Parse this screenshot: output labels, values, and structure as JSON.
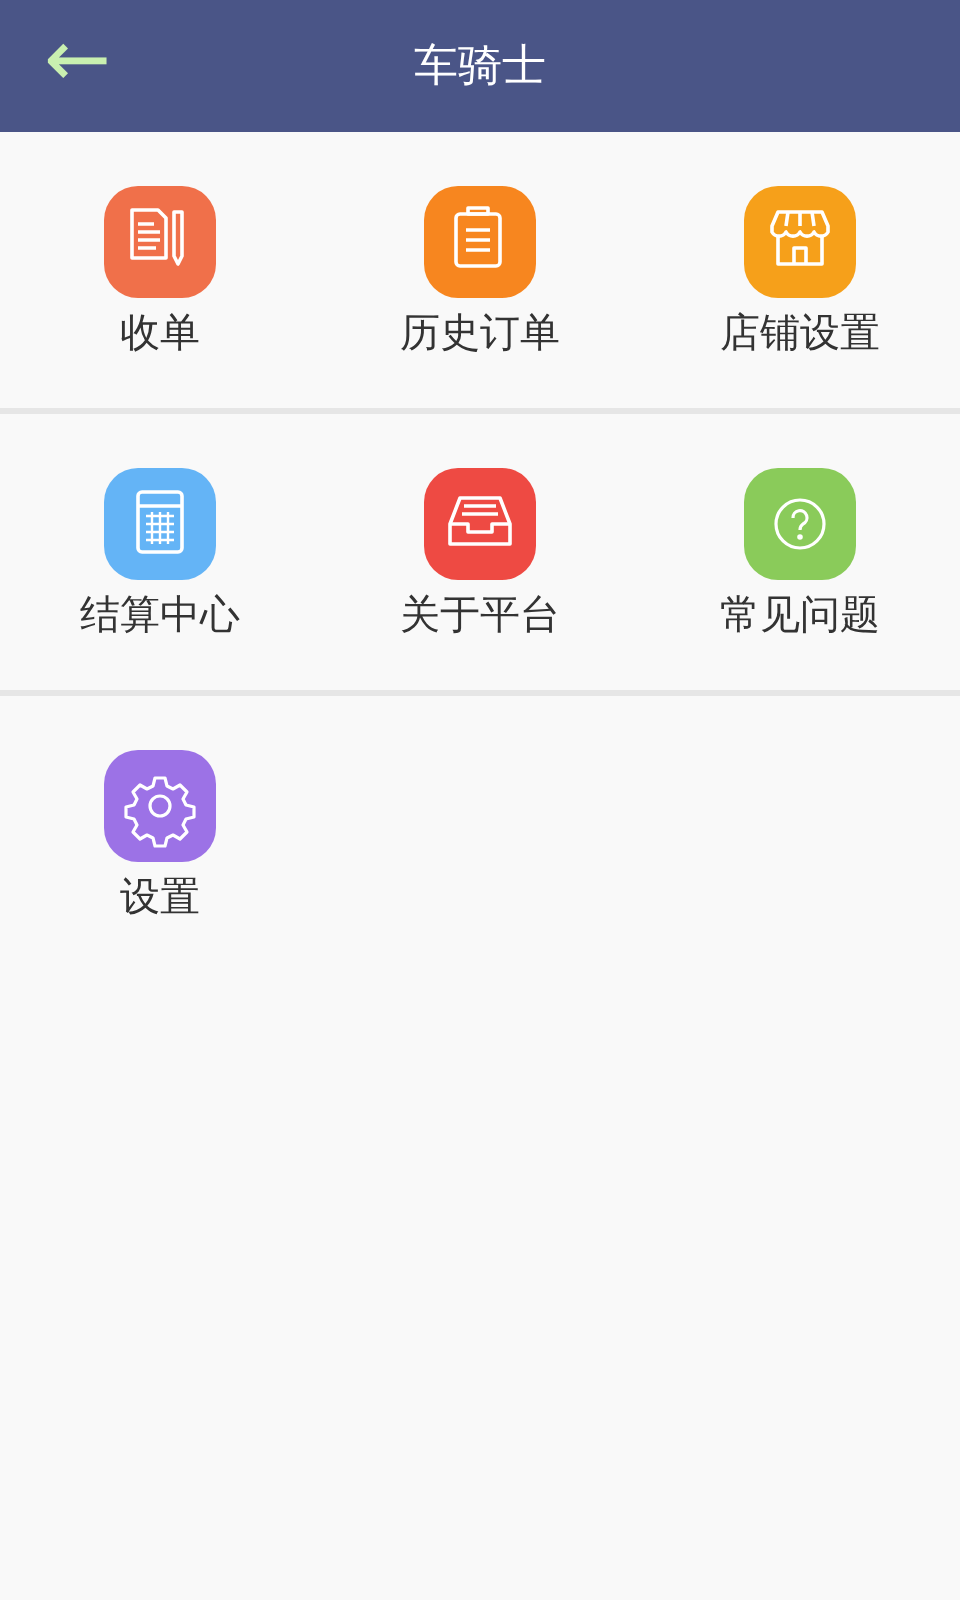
{
  "header": {
    "back": "←",
    "title": "车骑士"
  },
  "sections": [
    {
      "items": [
        {
          "label": "收单",
          "kind": "order",
          "color": "#f0704a"
        },
        {
          "label": "历史订单",
          "kind": "clipboard",
          "color": "#f7861f"
        },
        {
          "label": "店铺设置",
          "kind": "store",
          "color": "#f6a01a"
        }
      ]
    },
    {
      "items": [
        {
          "label": "结算中心",
          "kind": "calculator",
          "color": "#64b4f6"
        },
        {
          "label": "关于平台",
          "kind": "tray",
          "color": "#ee4a43"
        },
        {
          "label": "常见问题",
          "kind": "question",
          "color": "#8acb5a"
        }
      ]
    },
    {
      "items": [
        {
          "label": "设置",
          "kind": "gear",
          "color": "#9c72e6"
        }
      ]
    }
  ]
}
